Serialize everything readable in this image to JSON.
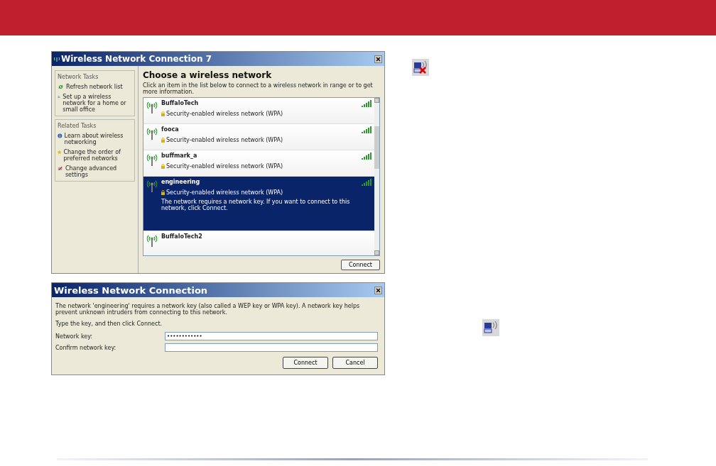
{
  "network_dialog": {
    "title": "Wireless Network Connection 7",
    "task_groups": [
      {
        "heading": "Network Tasks",
        "items": [
          {
            "kind": "refresh",
            "label": "Refresh network list"
          },
          {
            "kind": "setup",
            "label": "Set up a wireless network for a home or small office"
          }
        ]
      },
      {
        "heading": "Related Tasks",
        "items": [
          {
            "kind": "info",
            "label": "Learn about wireless networking"
          },
          {
            "kind": "star",
            "label": "Change the order of preferred networks"
          },
          {
            "kind": "settings",
            "label": "Change advanced settings"
          }
        ]
      }
    ],
    "heading": "Choose a wireless network",
    "instructions": "Click an item in the list below to connect to a wireless network in range or to get more information.",
    "networks": [
      {
        "name": "BuffaloTech",
        "security": "Security-enabled wireless network (WPA)",
        "selected": false
      },
      {
        "name": "fooca",
        "security": "Security-enabled wireless network (WPA)",
        "selected": false
      },
      {
        "name": "buffmark_a",
        "security": "Security-enabled wireless network (WPA)",
        "selected": false
      },
      {
        "name": "engineering",
        "security": "Security-enabled wireless network (WPA)",
        "note": "The network requires a network key. If you want to connect to this network, click Connect.",
        "selected": true
      },
      {
        "name": "BuffaloTech2",
        "selected": false
      }
    ],
    "connect_button": "Connect"
  },
  "key_dialog": {
    "title": "Wireless Network Connection",
    "message": "The network 'engineering' requires a network key (also called a WEP key or WPA key). A network key helps prevent unknown intruders from connecting to this network.",
    "instruction": "Type the key, and then click Connect.",
    "fields": [
      {
        "label": "Network key:",
        "value": "••••••••••••"
      },
      {
        "label": "Confirm network key:"
      }
    ],
    "buttons": [
      "Connect",
      "Cancel"
    ]
  }
}
